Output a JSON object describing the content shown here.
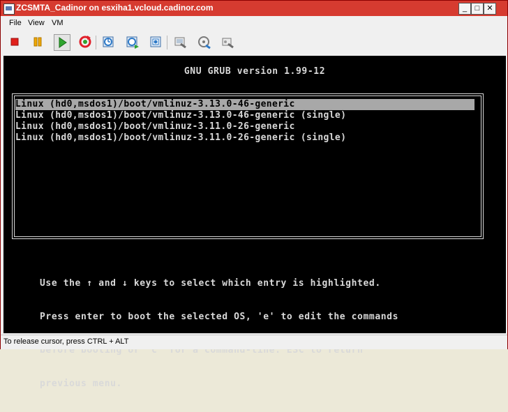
{
  "window": {
    "title": "ZCSMTA_Cadinor on esxiha1.vcloud.cadinor.com",
    "minimize": "_",
    "maximize": "□",
    "close": "✕"
  },
  "menu": {
    "items": [
      "File",
      "View",
      "VM"
    ]
  },
  "toolbar": {
    "icons": [
      "power-off-icon",
      "suspend-icon",
      "power-on-icon",
      "reset-icon",
      "snapshot-take-icon",
      "snapshot-revert-icon",
      "snapshot-manager-icon",
      "vm-settings-icon",
      "connect-device-icon",
      "disconnect-device-icon"
    ],
    "colors": {
      "stop": "#e0201b",
      "pause": "#f0a800",
      "play": "#2fa52f",
      "reset": "#e0202a"
    }
  },
  "grub": {
    "title": "GNU GRUB  version 1.99-12",
    "entries": [
      "Linux (hd0,msdos1)/boot/vmlinuz-3.13.0-46-generic",
      "Linux (hd0,msdos1)/boot/vmlinuz-3.13.0-46-generic (single)",
      "Linux (hd0,msdos1)/boot/vmlinuz-3.11.0-26-generic",
      "Linux (hd0,msdos1)/boot/vmlinuz-3.11.0-26-generic (single)"
    ],
    "help_lines": [
      "Use the ↑ and ↓ keys to select which entry is highlighted.",
      "Press enter to boot the selected OS, 'e' to edit the commands",
      "before booting or 'c' for a command-line. ESC to return",
      "previous menu."
    ]
  },
  "status": {
    "text": "To release cursor, press CTRL + ALT"
  }
}
